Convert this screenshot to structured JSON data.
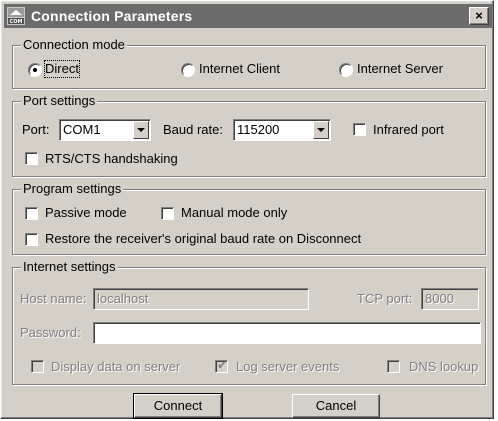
{
  "window": {
    "title": "Connection Parameters",
    "close_label": "×"
  },
  "connection_mode": {
    "legend": "Connection mode",
    "options": [
      {
        "label": "Direct",
        "selected": true
      },
      {
        "label": "Internet Client",
        "selected": false
      },
      {
        "label": "Internet Server",
        "selected": false
      }
    ]
  },
  "port_settings": {
    "legend": "Port settings",
    "port_label": "Port:",
    "port_value": "COM1",
    "baud_label": "Baud rate:",
    "baud_value": "115200",
    "infrared_label": "Infrared port",
    "infrared_checked": false,
    "rtscts_label": "RTS/CTS handshaking",
    "rtscts_checked": false
  },
  "program_settings": {
    "legend": "Program settings",
    "passive_label": "Passive mode",
    "passive_checked": false,
    "manual_label": "Manual mode only",
    "manual_checked": false,
    "restore_label": "Restore the receiver's original baud rate on Disconnect",
    "restore_checked": false
  },
  "internet_settings": {
    "legend": "Internet settings",
    "host_label": "Host name:",
    "host_value": "localhost",
    "tcp_label": "TCP port:",
    "tcp_value": "8000",
    "password_label": "Password:",
    "password_value": "",
    "display_label": "Display data on server",
    "display_checked": false,
    "log_label": "Log server events",
    "log_checked": true,
    "dns_label": "DNS lookup",
    "dns_checked": false
  },
  "buttons": {
    "connect": "Connect",
    "cancel": "Cancel"
  }
}
